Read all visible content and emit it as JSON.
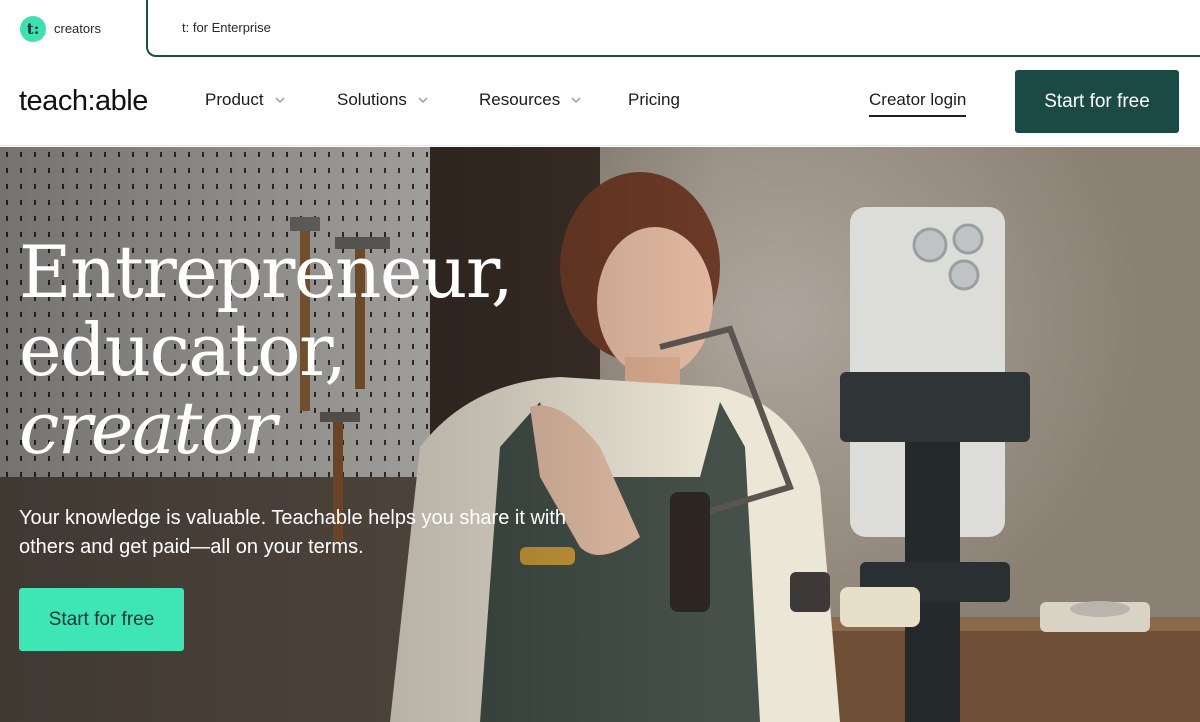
{
  "audience_switcher": {
    "creators_icon": "t:",
    "creators_label": "creators",
    "enterprise_label": "t: for Enterprise"
  },
  "nav": {
    "brand": "teach:able",
    "items": [
      {
        "label": "Product",
        "has_dropdown": true
      },
      {
        "label": "Solutions",
        "has_dropdown": true
      },
      {
        "label": "Resources",
        "has_dropdown": true
      },
      {
        "label": "Pricing",
        "has_dropdown": false
      }
    ],
    "login_label": "Creator login",
    "cta_label": "Start for free"
  },
  "hero": {
    "headline_line1": "Entrepreneur,",
    "headline_line2": "educator,",
    "headline_line3": "creator",
    "subcopy": "Your knowledge is valuable. Teachable helps you share it with others and get paid—all on your terms.",
    "cta_label": "Start for free"
  },
  "colors": {
    "brand_dark": "#1b4a45",
    "brand_mint": "#3fe6b5",
    "logo_mint": "#3fe0b0"
  },
  "icons": {
    "dropdown": "chevron-down-icon",
    "logo_badge": "teachable-t-logo-icon"
  }
}
